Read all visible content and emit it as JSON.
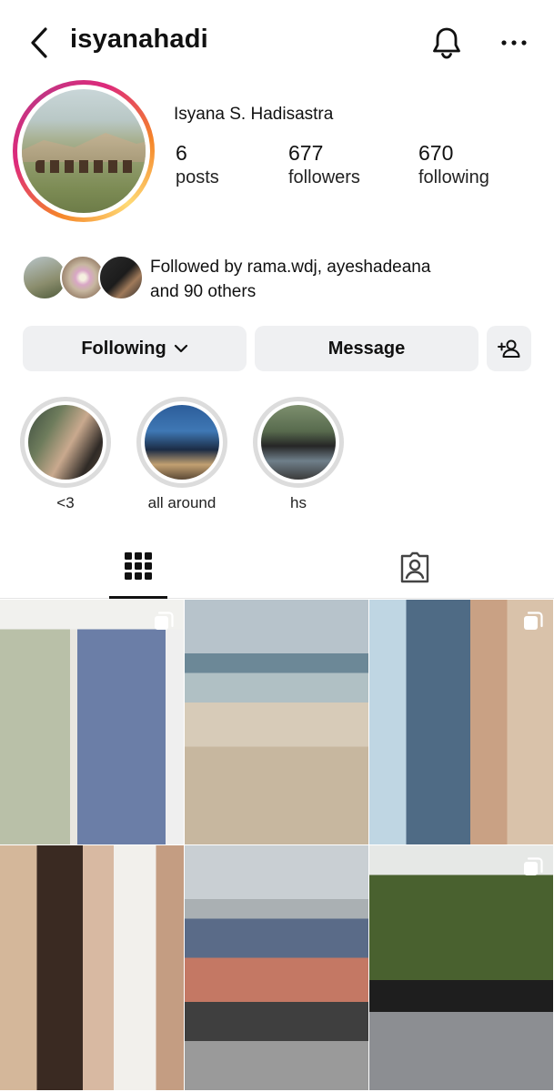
{
  "header": {
    "username": "isyanahadi"
  },
  "profile": {
    "full_name": "Isyana S. Hadisastra",
    "stats": [
      {
        "value": "6",
        "label": "posts"
      },
      {
        "value": "677",
        "label": "followers"
      },
      {
        "value": "670",
        "label": "following"
      }
    ],
    "followed_by_line1": "Followed by rama.wdj, ayeshadeana",
    "followed_by_line2": "and 90 others"
  },
  "buttons": {
    "following": "Following",
    "message": "Message"
  },
  "highlights": [
    {
      "label": "<3"
    },
    {
      "label": "all around"
    },
    {
      "label": "hs"
    }
  ],
  "icons": {
    "back": "back-arrow-icon",
    "bell": "bell-icon",
    "more": "more-icon",
    "add_user": "add-user-icon",
    "grid": "grid-icon",
    "tagged": "tagged-icon",
    "multi": "multiple-photos-icon"
  }
}
